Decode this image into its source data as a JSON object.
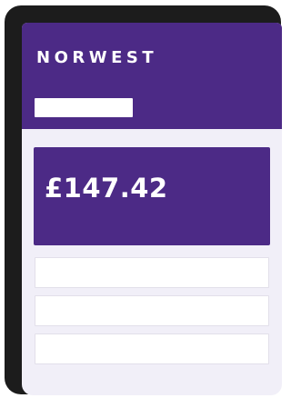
{
  "app": {
    "brand_name": "NORWEST"
  },
  "balance": {
    "amount": "£147.42"
  },
  "colors": {
    "brand_purple": "#4c2a86",
    "screen_background": "#f1eff8",
    "frame": "#1c1c1c"
  }
}
